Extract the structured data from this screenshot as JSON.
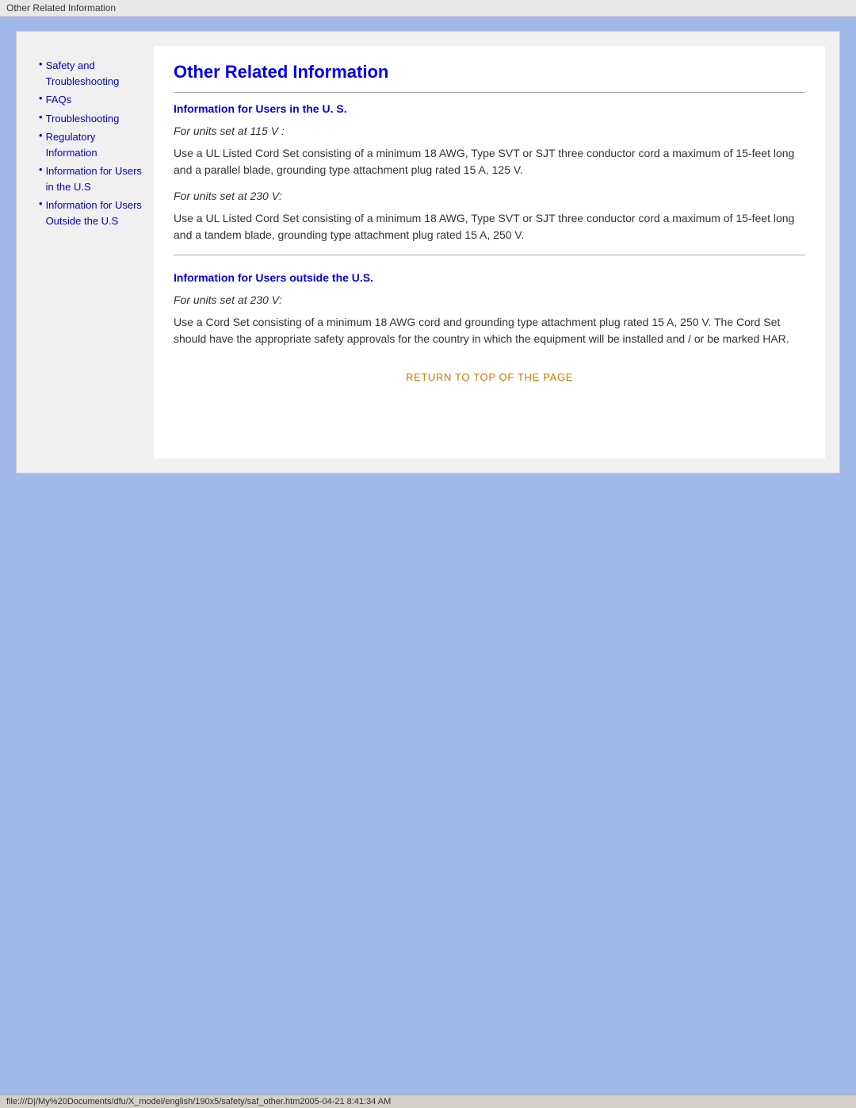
{
  "titleBar": {
    "label": "Other Related Information"
  },
  "sidebar": {
    "items": [
      {
        "label": "Safety and Troubleshooting",
        "href": "#"
      },
      {
        "label": "FAQs",
        "href": "#"
      },
      {
        "label": "Troubleshooting",
        "href": "#"
      },
      {
        "label": "Regulatory Information",
        "href": "#"
      },
      {
        "label": "Information for Users in the U.S",
        "href": "#"
      },
      {
        "label": "Information for Users Outside the U.S",
        "href": "#"
      }
    ]
  },
  "main": {
    "pageTitle": "Other Related Information",
    "section1": {
      "heading": "Information for Users in the U. S.",
      "subheading1": "For units set at 115 V :",
      "body1": "Use a UL Listed Cord Set consisting of a minimum 18 AWG, Type SVT or SJT three conductor cord a maximum of 15-feet long and a parallel blade, grounding type attachment plug rated 15 A, 125 V.",
      "subheading2": "For units set at 230 V:",
      "body2": "Use a UL Listed Cord Set consisting of a minimum 18 AWG, Type SVT or SJT three conductor cord a maximum of 15-feet long and a tandem blade, grounding type attachment plug rated 15 A, 250 V."
    },
    "section2": {
      "heading": "Information for Users outside the U.S.",
      "subheading1": "For units set at 230 V:",
      "body1": "Use a Cord Set consisting of a minimum 18 AWG cord and grounding type attachment plug rated 15 A, 250 V. The Cord Set should have the appropriate safety approvals for the country in which the equipment will be installed and / or be marked HAR."
    },
    "returnLink": "RETURN TO TOP OF THE PAGE"
  },
  "statusBar": {
    "text": "file:///D|/My%20Documents/dfu/X_model/english/190x5/safety/saf_other.htm2005-04-21  8:41:34 AM"
  }
}
